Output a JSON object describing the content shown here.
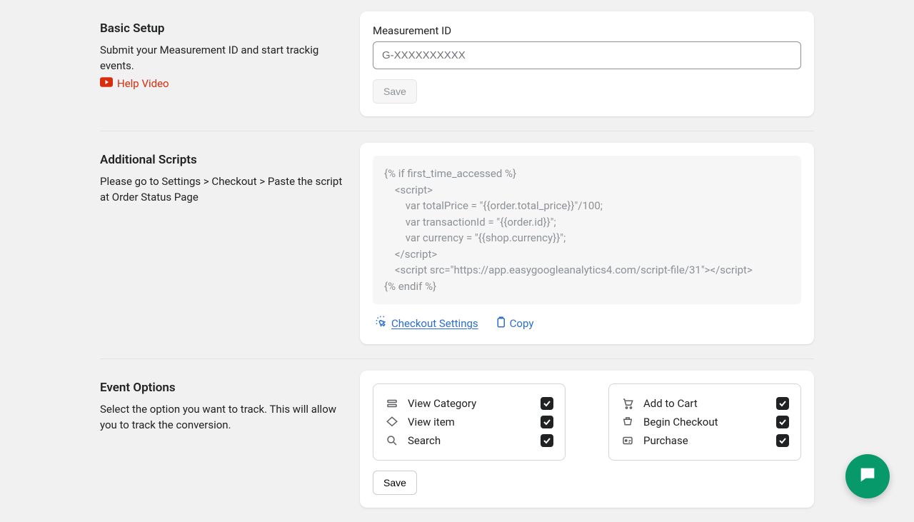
{
  "basic": {
    "title": "Basic Setup",
    "desc": "Submit your Measurement ID and start trackig events.",
    "help_label": "Help Video",
    "field_label": "Measurement ID",
    "placeholder": "G-XXXXXXXXXX",
    "save_label": "Save"
  },
  "scripts": {
    "title": "Additional Scripts",
    "desc": "Please go to Settings > Checkout > Paste the script at Order Status Page",
    "code": "{% if first_time_accessed %}\n    <script>\n        var totalPrice = \"{{order.total_price}}\"/100;\n        var transactionId = \"{{order.id}}\";\n        var currency = \"{{shop.currency}}\";\n    </script>\n    <script src=\"https://app.easygoogleanalytics4.com/script-file/31\"></script>\n{% endif %}",
    "checkout_label": "Checkout Settings",
    "copy_label": "Copy"
  },
  "events": {
    "title": "Event Options",
    "desc": "Select the option you want to track. This will allow you to track the conversion.",
    "left": [
      {
        "label": "View Category"
      },
      {
        "label": "View item"
      },
      {
        "label": "Search"
      }
    ],
    "right": [
      {
        "label": "Add to Cart"
      },
      {
        "label": "Begin Checkout"
      },
      {
        "label": "Purchase"
      }
    ],
    "save_label": "Save"
  }
}
